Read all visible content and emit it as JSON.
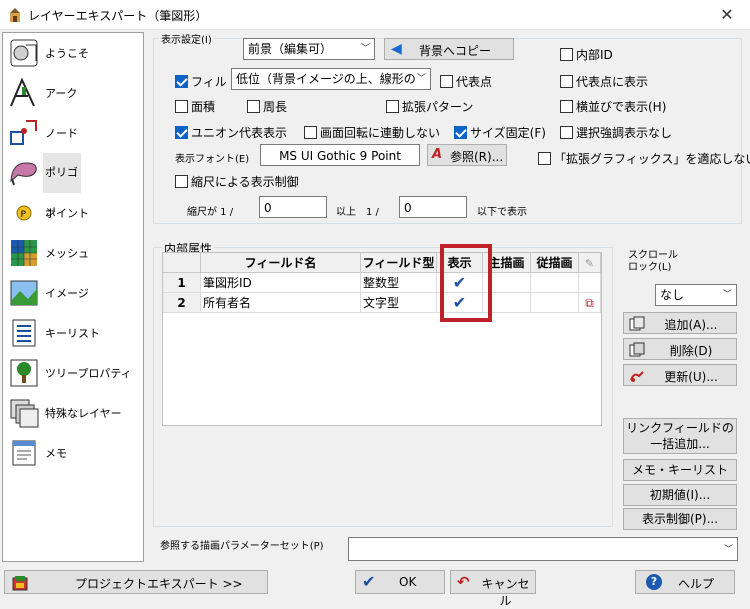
{
  "title": "レイヤーエキスパート（筆図形）",
  "nav": [
    {
      "label": "ようこそ"
    },
    {
      "label": "アーク"
    },
    {
      "label": "ノード"
    },
    {
      "label": "ポリゴン"
    },
    {
      "label": "ポイント"
    },
    {
      "label": "メッシュ"
    },
    {
      "label": "イメージ"
    },
    {
      "label": "キーリスト"
    },
    {
      "label": "ツリープロパティ"
    },
    {
      "label": "特殊なレイヤー"
    },
    {
      "label": "メモ"
    }
  ],
  "display": {
    "group_label": "表示設定(I)",
    "layer_combo": "前景（編集可）",
    "copy_bg_button": "背景へコピー",
    "fill_label": "フィル",
    "fill_combo": "低位（背景イメージの上、線形の",
    "area_label": "面積",
    "perimeter_label": "周長",
    "ext_pattern_label": "拡張パターン",
    "union_label": "ユニオン代表表示",
    "rotate_label": "画面回転に連動しない",
    "size_fixed_label": "サイズ固定(F)",
    "select_highlight_label": "選択強調表示なし",
    "internal_id_label": "内部ID",
    "rep_point_label": "代表点",
    "rep_point_display_label": "代表点に表示",
    "horizontal_label": "横並びで表示(H)",
    "font_label": "表示フォント(E)",
    "font_value": "MS UI Gothic 9 Point",
    "ref_button": "参照(R)...",
    "ext_graphics_label": "「拡張グラフィックス」を適応しない",
    "scale_control_label": "縮尺による表示制御",
    "scale_prefix": "縮尺が 1 /",
    "scale_from": "0",
    "scale_mid": "以上　1 /",
    "scale_to": "0",
    "scale_suffix": "以下で表示"
  },
  "internal": {
    "group_label": "内部属性",
    "columns": [
      "フィールド名",
      "フィールド型",
      "表示",
      "主描画",
      "従描画"
    ],
    "rows": [
      {
        "num": "1",
        "name": "筆図形ID",
        "type": "整数型",
        "show": "✔"
      },
      {
        "num": "2",
        "name": "所有者名",
        "type": "文字型",
        "show": "✔"
      }
    ]
  },
  "scroll_lock_label": "スクロール\nロック(L)",
  "scroll_lock_value": "なし",
  "side_buttons": {
    "add": "追加(A)...",
    "delete": "削除(D)",
    "update": "更新(U)...",
    "link_field": "リンクフィールドの\n一括追加...",
    "memo_keylist": "メモ・キーリスト >>",
    "initial": "初期値(I)...",
    "display_control": "表示制御(P)..."
  },
  "param_set_label": "参照する描画パラメーターセット(P)",
  "param_set_value": "",
  "bottom": {
    "project_expert": "プロジェクトエキスパート >>",
    "ok": "OK",
    "cancel": "キャンセル",
    "help": "ヘルプ"
  },
  "colors": {
    "accent": "#0a64c8",
    "highlight_box": "#c0202a"
  }
}
